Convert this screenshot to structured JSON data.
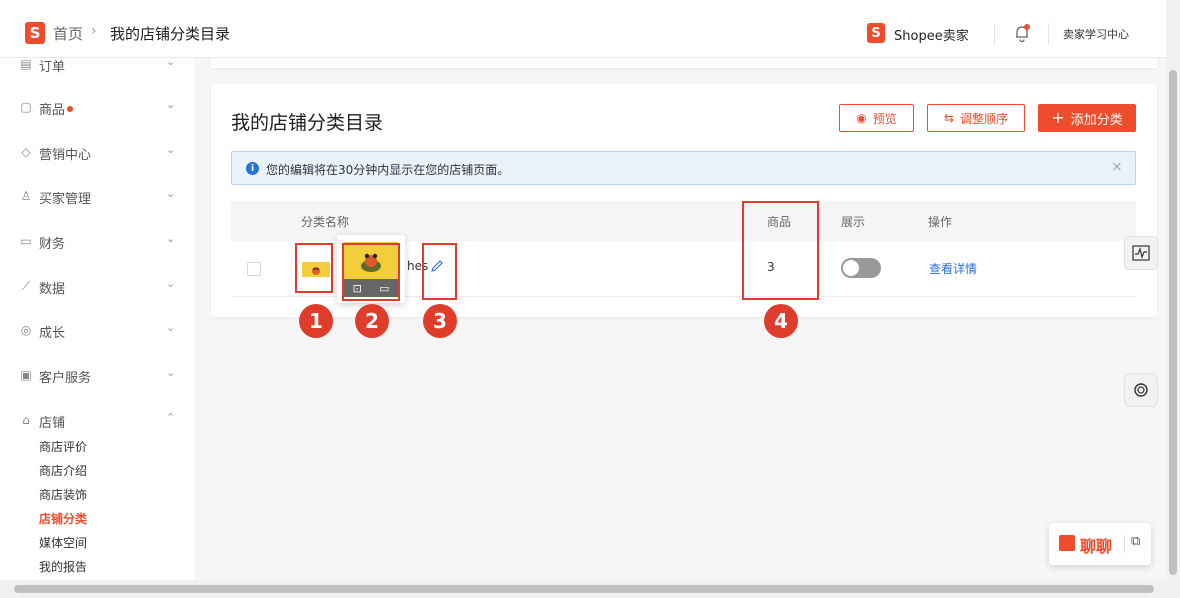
{
  "header": {
    "logo_letter": "S",
    "breadcrumb_home": "首页",
    "breadcrumb_sep": "›",
    "breadcrumb_current": "我的店铺分类目录",
    "seller_brand": "Shopee卖家",
    "learning_center": "卖家学习中心"
  },
  "sidebar": {
    "items": [
      {
        "label": "订单",
        "icon": "order-icon",
        "chevron": "⌄"
      },
      {
        "label": "商品",
        "icon": "product-icon",
        "chevron": "⌄",
        "dot": true
      },
      {
        "label": "营销中心",
        "icon": "tag-icon",
        "chevron": "⌄"
      },
      {
        "label": "买家管理",
        "icon": "user-icon",
        "chevron": "⌄"
      },
      {
        "label": "财务",
        "icon": "wallet-icon",
        "chevron": "⌄"
      },
      {
        "label": "数据",
        "icon": "chart-icon",
        "chevron": "⌄"
      },
      {
        "label": "成长",
        "icon": "medal-icon",
        "chevron": "⌄"
      },
      {
        "label": "客户服务",
        "icon": "chat-icon",
        "chevron": "⌄"
      },
      {
        "label": "店铺",
        "icon": "shop-icon",
        "chevron": "⌃"
      }
    ],
    "shop_subitems": [
      "商店评价",
      "商店介绍",
      "商店装饰",
      "店铺分类",
      "媒体空间",
      "我的报告"
    ],
    "active_subitem": "店铺分类"
  },
  "main": {
    "title": "我的店铺分类目录",
    "preview_button": "预览",
    "reorder_button": "调整顺序",
    "add_button": "添加分类",
    "alert_text": "您的编辑将在30分钟内显示在您的店铺页面。",
    "alert_close": "×",
    "table": {
      "columns": [
        "分类名称",
        "商品",
        "展示",
        "操作"
      ],
      "rows": [
        {
          "name_suffix": "hes",
          "products": "3",
          "visible": false,
          "action": "查看详情"
        }
      ]
    }
  },
  "annotations": [
    "1",
    "2",
    "3",
    "4"
  ],
  "chat": {
    "label": "聊聊"
  },
  "colors": {
    "brand": "#ee4d2d",
    "link": "#2673dd",
    "annotation": "#e03c2c"
  }
}
